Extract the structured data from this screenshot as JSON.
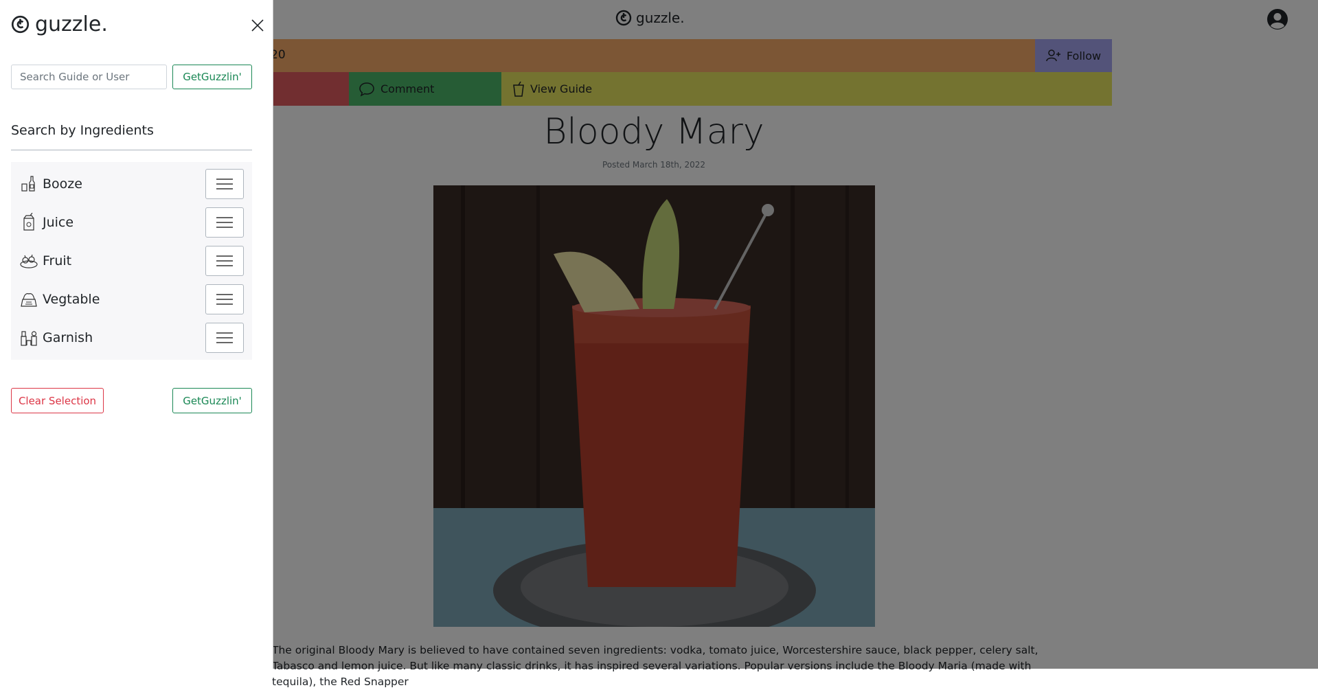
{
  "header": {
    "brand": "guzzle.",
    "follow_label": "Follow",
    "partial_count": "20"
  },
  "actions": {
    "comment_label": "Comment",
    "view_guide_label": "View Guide"
  },
  "post": {
    "title": "Bloody Mary",
    "posted": "Posted March 18th, 2022",
    "body": "The original Bloody Mary is believed to have contained seven ingredients: vodka, tomato juice, Worcestershire sauce, black pepper, celery salt, Tabasco and lemon juice. But like many classic drinks, it has inspired several variations. Popular versions include the Bloody Maria (made with tequila), the Red Snapper"
  },
  "sidebar": {
    "brand": "guzzle.",
    "search_placeholder": "Search Guide or User",
    "search_button": "GetGuzzlin'",
    "section_title": "Search by Ingredients",
    "ingredients": [
      {
        "label": "Booze",
        "icon": "bottles-icon"
      },
      {
        "label": "Juice",
        "icon": "juice-box-icon"
      },
      {
        "label": "Fruit",
        "icon": "fruit-icon"
      },
      {
        "label": "Vegtable",
        "icon": "vegetable-icon"
      },
      {
        "label": "Garnish",
        "icon": "garnish-icon"
      }
    ],
    "clear_button": "Clear Selection",
    "guzzle_button": "GetGuzzlin'"
  },
  "colors": {
    "row1": "#f8ad6a",
    "follow": "#a6a6f3",
    "like": "#e35d60",
    "comment": "#4db86a",
    "view_guide": "#e8e661",
    "success": "#198754",
    "danger": "#dc3545"
  }
}
